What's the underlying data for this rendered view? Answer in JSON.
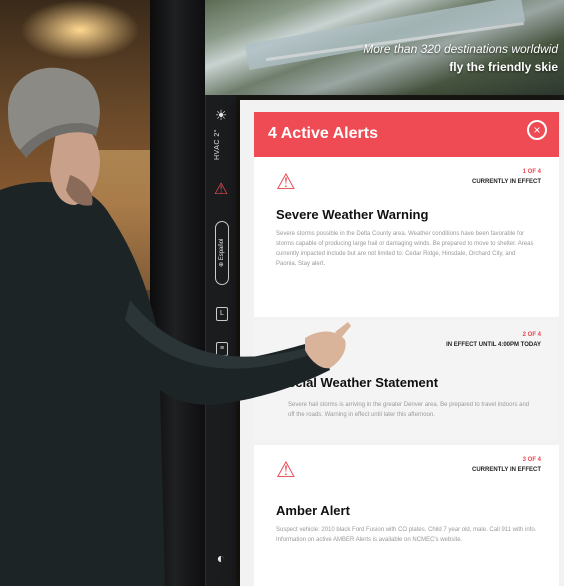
{
  "tagline": {
    "line1": "More than 320 destinations worldwid",
    "line2": "fly the friendly skie"
  },
  "rail": {
    "sun_icon": "☀",
    "weather": "HVAC 2°",
    "alert_icon": "⚠",
    "espanol": "⊕ Español",
    "box1": "L",
    "box2": "≡",
    "globe_icon": "◐"
  },
  "panel": {
    "title": "4 Active Alerts",
    "close_icon": "×",
    "alerts": [
      {
        "counter": "1 OF 4",
        "status": "CURRENTLY IN EFFECT",
        "title": "Severe Weather Warning",
        "body": "Severe storms possible in the Delta County area. Weather conditions have been favorable for storms capable of producing large hail or damaging winds. Be prepared to move to shelter. Areas currently impacted include but are not limited to: Cedar Ridge, Hinsdale, Orchard City, and Paonia. Stay alert."
      },
      {
        "counter": "2 OF 4",
        "status": "IN EFFECT UNTIL 4:00PM TODAY",
        "title": "ecial Weather Statement",
        "body": "Severe hail storms is arriving in the greater Denver area. Be prepared to travel indoors and off the roads. Warning in effect until later this afternoon."
      },
      {
        "counter": "3 OF 4",
        "status": "CURRENTLY IN EFFECT",
        "title": "Amber Alert",
        "body": "Suspect vehicle: 2010 black Ford Fusion with CO plates. Child 7 year old, male. Call 911 with info. Information on active AMBER Alerts is available on NCMEC's website."
      }
    ]
  },
  "icons": {
    "warning": "⚠"
  }
}
